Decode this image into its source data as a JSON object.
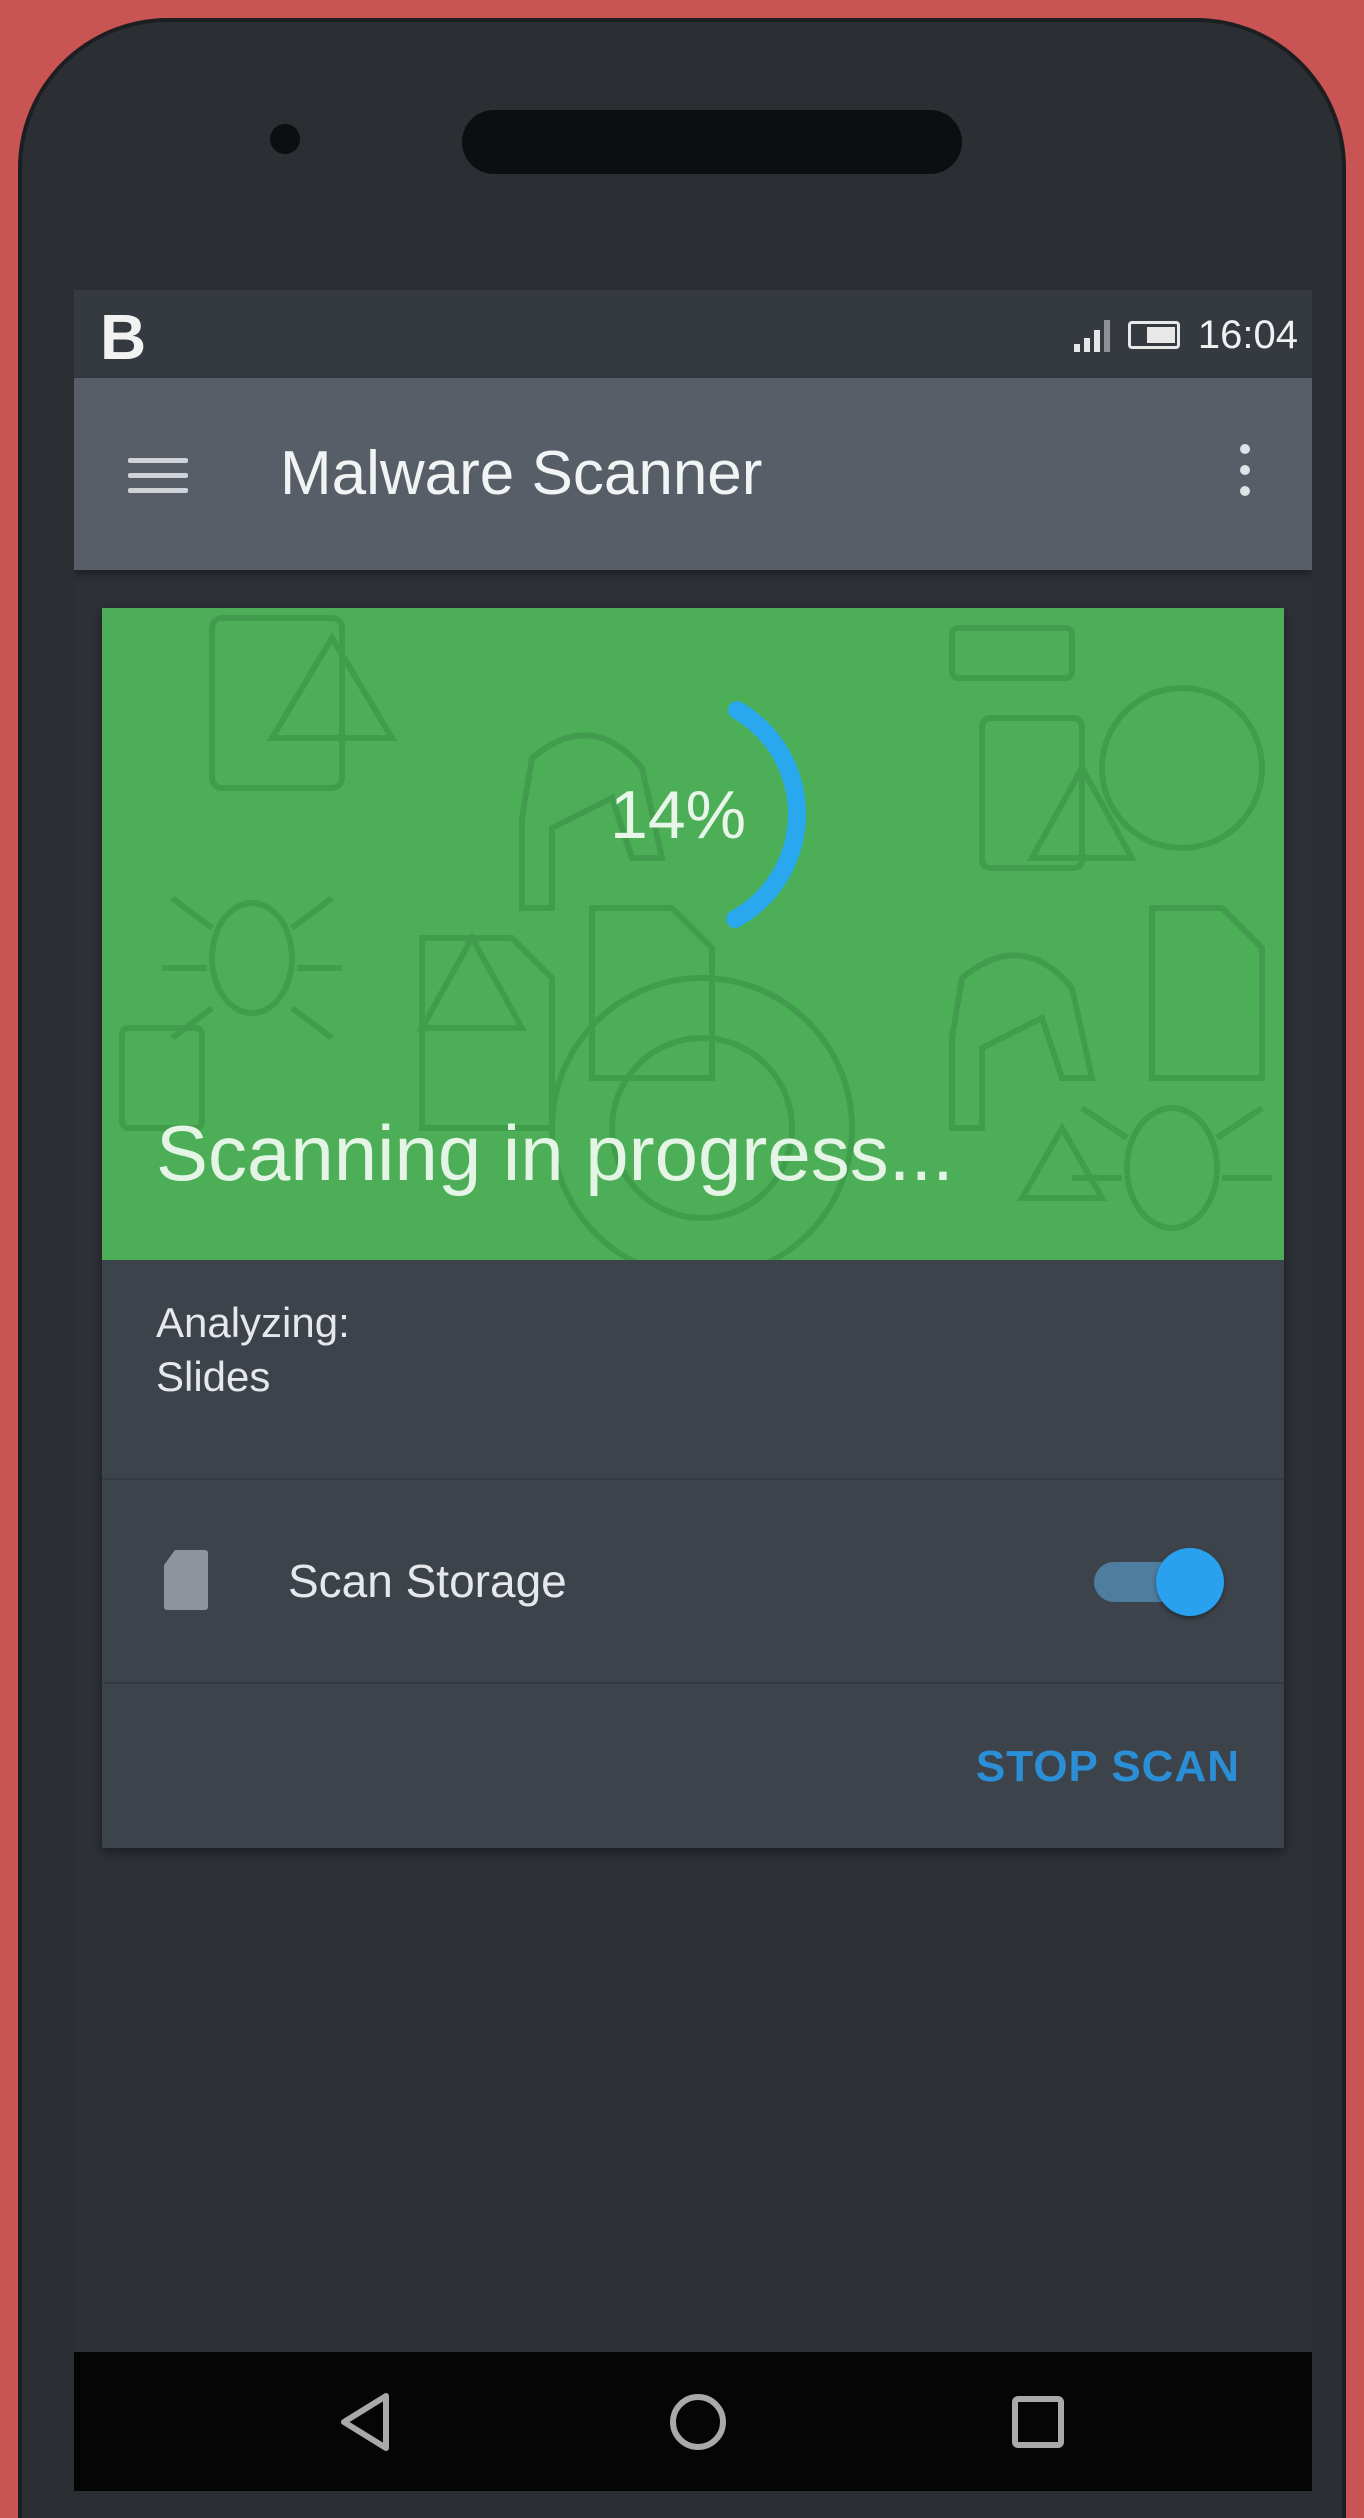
{
  "status_bar": {
    "logo": "B",
    "time": "16:04",
    "icons": [
      "signal-icon",
      "battery-icon"
    ]
  },
  "app_bar": {
    "title": "Malware Scanner",
    "icons": [
      "menu-icon",
      "more-vertical-icon"
    ]
  },
  "scan": {
    "progress_percent": 14,
    "progress_label": "14%",
    "status": "Scanning in progress...",
    "background_icons": [
      "warning-icon",
      "bug-icon",
      "trojan-horse-icon",
      "file-icon",
      "radar-icon",
      "phone-icon"
    ]
  },
  "analyzing": {
    "label": "Analyzing:",
    "value": "Slides"
  },
  "storage": {
    "label": "Scan Storage",
    "enabled": true,
    "icon": "sd-card-icon"
  },
  "actions": {
    "stop_label": "STOP SCAN"
  },
  "nav_bar": {
    "icons": [
      "back-icon",
      "home-icon",
      "recents-icon"
    ]
  },
  "colors": {
    "banner_green": "#4caf57",
    "accent_blue": "#2a8fd6",
    "progress_arc": "#29a8f0",
    "frame_red": "#c85454"
  }
}
